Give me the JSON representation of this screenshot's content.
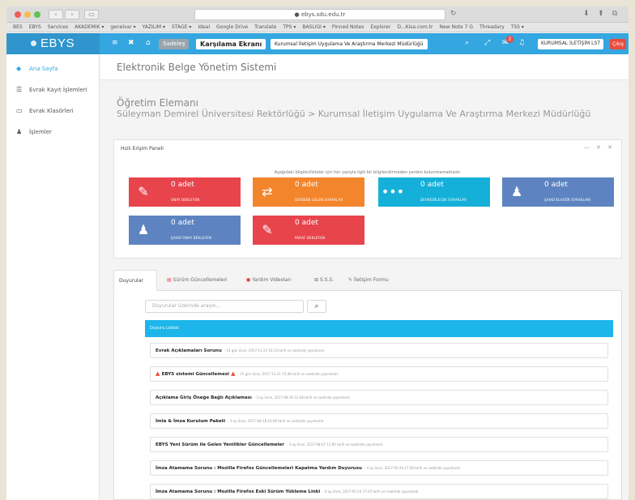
{
  "browser": {
    "url": "● ebys.sdu.edu.tr",
    "bookmarks": [
      "BES",
      "EBYS",
      "Services",
      "AKADEMIK ▾",
      "genelvar ▾",
      "YAZILIM ▾",
      "STAGE ▾",
      "Ideal",
      "Google Drive",
      "Translate",
      "TPS ▾",
      "BASLIGI ▾",
      "Pinned Notes",
      "Explorer",
      "D...Kisa.com.tr",
      "New Note 7 G",
      "Threadary",
      "TSS ▾"
    ]
  },
  "header": {
    "logo": "EBYS",
    "env_label": "Sadeleş",
    "welcome_label": "Karşılama Ekranı",
    "unit_select": "Kurumsal İletişim Uygulama Ve Araştırma Merkezi Müdürlüğü",
    "notification_count": "2",
    "user_label": "KURUMSAL İLETİŞİM LST",
    "exit_label": "Çıkış"
  },
  "sidebar": {
    "items": [
      {
        "label": "Ana Sayfa",
        "icon": "home-icon"
      },
      {
        "label": "Evrak Kayıt İşlemleri",
        "icon": "list-icon"
      },
      {
        "label": "Evrak Klasörleri",
        "icon": "folder-icon"
      },
      {
        "label": "İşlemler",
        "icon": "user-icon"
      }
    ]
  },
  "main": {
    "system_title": "Elektronik Belge Yönetim Sistemi",
    "user_role": "Öğretim Elemanı",
    "user_unit": "Süleyman Demirel Üniversitesi Rektörlüğü > Kurumsal İletişim Uygulama Ve Araştırma Merkezi Müdürlüğü",
    "panel_title": "Hızlı Erişim Paneli",
    "panel_tools": "— ✕ ✕",
    "panel_note": "Aşağıdaki bilgiler/listeler için her yazıyla ilgili bir bilgilendirmeden yardım bulunmamaktadır.",
    "cards": [
      {
        "count": "0 adet",
        "label": "ONAY BEKLEYEN",
        "color": "#e8444c",
        "icon": "pencil-icon"
      },
      {
        "count": "0 adet",
        "label": "GERİDEN GELEN EVRAKLAR",
        "color": "#f3852d",
        "icon": "retweet-icon"
      },
      {
        "count": "0 adet",
        "label": "DEVREDİLECEK EVRAKLAR",
        "color": "#15b0d9",
        "icon": "more-icon"
      },
      {
        "count": "0 adet",
        "label": "ŞAHSİ KLASÖR EVRAKLARI",
        "color": "#5d84c1",
        "icon": "user-icon"
      },
      {
        "count": "0 adet",
        "label": "ŞAHSİ ONAY BEKLEYEN",
        "color": "#5d84c1",
        "icon": "user-icon"
      },
      {
        "count": "0 adet",
        "label": "PARAF BEKLEYEN",
        "color": "#e8444c",
        "icon": "pencil-icon"
      }
    ],
    "tabs": [
      {
        "label": "Duyurular"
      },
      {
        "label": "Sürüm Güncellemeleri"
      },
      {
        "label": "Yardım Videoları"
      },
      {
        "label": "S.S.S."
      },
      {
        "label": "İletişim Formu"
      }
    ],
    "search_placeholder": "Duyurular üzerinde arayın...",
    "list_header": "Duyuru Listesi",
    "announcements": [
      {
        "title": "Evrak Açıklamaları Sorunu",
        "meta": "- 14 gün önce, 2017-11-22 16:13 tarih ve saatinde yayınlandı.",
        "warn": false
      },
      {
        "title": "EBYS sistemi Güncellemesi",
        "meta": "- 15 gün önce, 2017-11-21 15:48 tarih ve saatinde yayınlandı.",
        "warn": true
      },
      {
        "title": "Açıklama Giriş Öneğe Bağlı Açıklaması",
        "meta": "- 3 ay önce, 2017-08-18 12:08 tarih ve saatinde yayınlandı.",
        "warn": false
      },
      {
        "title": "İmla & İmza Kurulum Paketi",
        "meta": "- 3 ay önce, 2017-08-18 10:58 tarih ve saatinde yayınlandı.",
        "warn": false
      },
      {
        "title": "EBYS Yeni Sürüm ile Gelen Yenilikler Güncellemeler",
        "meta": "- 3 ay önce, 2017-08-07 11:00 tarih ve saatinde yayınlandı.",
        "warn": false
      },
      {
        "title": "İmza Atamama Sorunu : Mozilla Firefox Güncellemeleri Kapatma Yardım Duyurusu",
        "meta": "- 4 ay önce, 2017-05-24 17:58 tarih ve saatinde yayınlandı.",
        "warn": false
      },
      {
        "title": "İmza Atamama Sorunu : Mozilla Firefox Eski Sürüm Yükleme Linki",
        "meta": "- 4 ay önce, 2017-05-24 17:45 tarih ve saatinde yayınlandı.",
        "warn": false
      }
    ]
  }
}
